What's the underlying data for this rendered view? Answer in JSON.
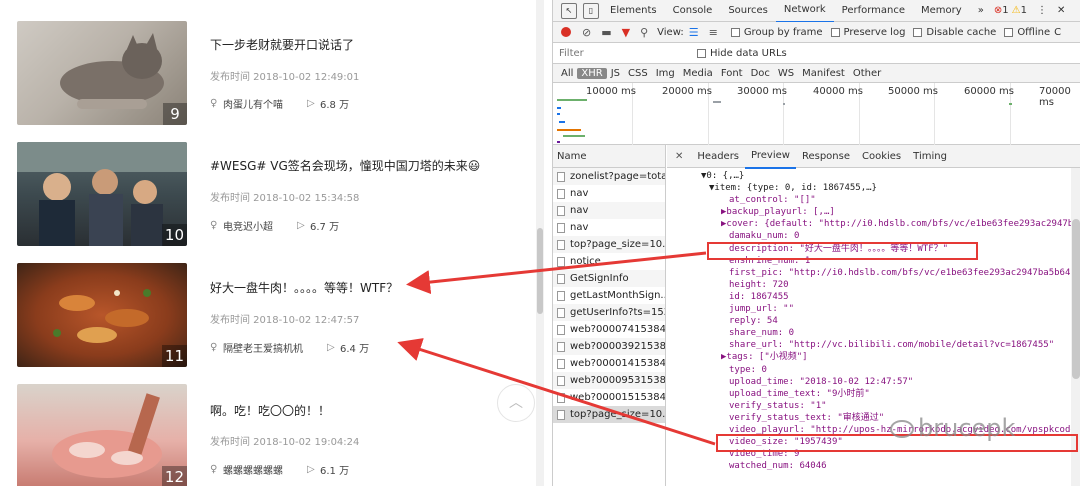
{
  "feed": {
    "items": [
      {
        "title": "下一步老财就要开口说话了",
        "time": "发布时间 2018-10-02 12:49:01",
        "author": "肉蛋儿有个喵",
        "plays": "6.8 万",
        "rank": "9"
      },
      {
        "title": "#WESG# VG签名会现场，憧现中国刀塔的未来😃",
        "time": "发布时间 2018-10-02 15:34:58",
        "author": "电竞迟小超",
        "plays": "6.7 万",
        "rank": "10"
      },
      {
        "title": "好大一盘牛肉！。。。。等等！WTF？",
        "time": "发布时间 2018-10-02 12:47:57",
        "author": "隔壁老王爱搞机机",
        "plays": "6.4 万",
        "rank": "11"
      },
      {
        "title": "啊。吃！吃〇〇的！！",
        "time": "发布时间 2018-10-02 19:04:24",
        "author": "螺螺螺螺螺螺",
        "plays": "6.1 万",
        "rank": "12"
      }
    ],
    "back_to_top": "︿"
  },
  "devtools": {
    "tabs": [
      "Elements",
      "Console",
      "Sources",
      "Network",
      "Performance",
      "Memory",
      "»"
    ],
    "errors": "1",
    "warnings": "1",
    "toolbar": {
      "view_label": "View:",
      "group_by_frame": "Group by frame",
      "preserve_log": "Preserve log",
      "disable_cache": "Disable cache",
      "offline": "Offline",
      "cut": "C"
    },
    "filter": {
      "placeholder": "Filter",
      "hide_data_urls": "Hide data URLs"
    },
    "types": [
      "All",
      "XHR",
      "JS",
      "CSS",
      "Img",
      "Media",
      "Font",
      "Doc",
      "WS",
      "Manifest",
      "Other"
    ],
    "timeline_labels": [
      "10000 ms",
      "20000 ms",
      "30000 ms",
      "40000 ms",
      "50000 ms",
      "60000 ms",
      "70000 ms"
    ],
    "list_header": "Name",
    "requests": [
      "zonelist?page=tota...",
      "nav",
      "nav",
      "nav",
      "top?page_size=10...",
      "notice",
      "GetSignInfo",
      "getLastMonthSign...",
      "getUserInfo?ts=153...",
      "web?00007415384...",
      "web?00003921538...",
      "web?00001415384...",
      "web?00009531538...",
      "web?00001515384...",
      "top?page_size=10..."
    ],
    "detail_tabs": [
      "Headers",
      "Preview",
      "Response",
      "Cookies",
      "Timing"
    ],
    "preview_lines": [
      "▼0: {,…}",
      "▼item: {type: 0, id: 1867455,…}",
      "at_control: \"[]\"",
      "▶backup_playurl: [,…]",
      "▶cover: {default: \"http://i0.hdslb.com/bfs/vc/e1be63fee293ac2947ba",
      "damaku_num: 0",
      "description: \"好大一盘牛肉！。。。。等等！WTF？\"",
      "enshrine_num: 1",
      "first_pic: \"http://i0.hdslb.com/bfs/vc/e1be63fee293ac2947ba5b64f",
      "height: 720",
      "id: 1867455",
      "jump_url: \"\"",
      "reply: 54",
      "share_num: 0",
      "share_url: \"http://vc.bilibili.com/mobile/detail?vc=1867455\"",
      "▶tags: [\"小视频\"]",
      "type: 0",
      "upload_time: \"2018-10-02 12:47:57\"",
      "upload_time_text: \"9小时前\"",
      "verify_status: \"1\"",
      "verify_status_text: \"审核通过\"",
      "video_playurl: \"http://upos-hz-mirrorkodo.acgvideo.com/vpspkcode/",
      "video_size: \"1957439\"",
      "video_time: 9",
      "watched_num: 64046"
    ]
  },
  "watermark": "brucepk",
  "colors": {
    "arrow": "#e53935",
    "accent": "#1a73e8",
    "record": "#d93025"
  }
}
